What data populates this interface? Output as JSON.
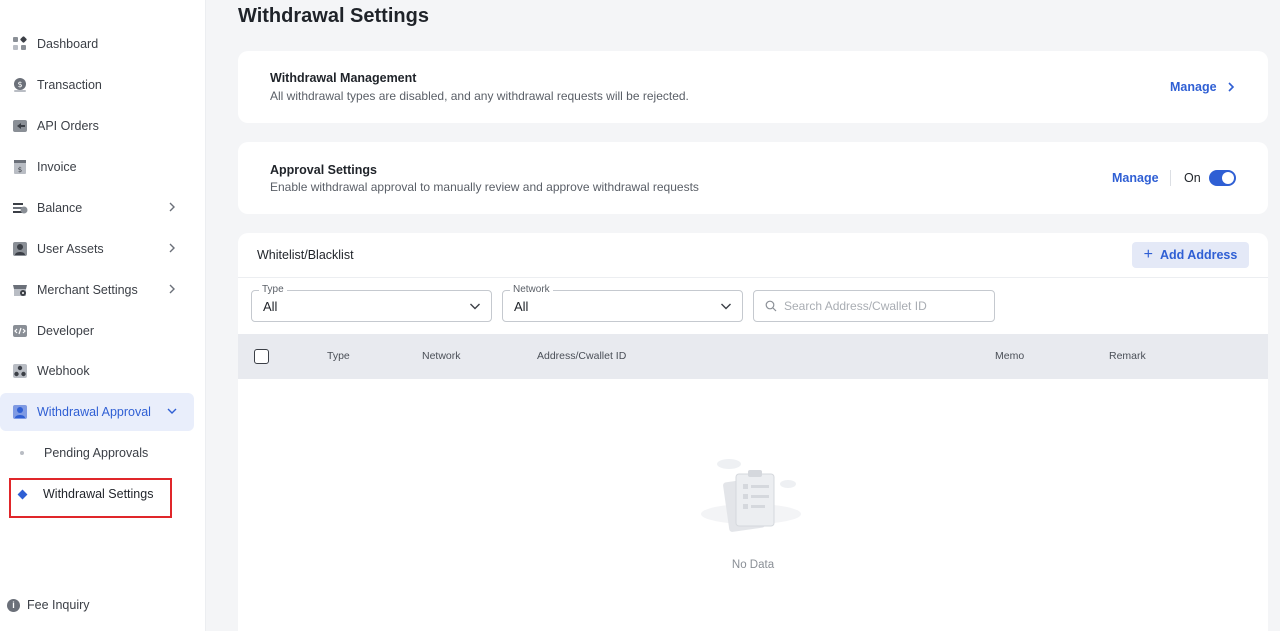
{
  "sidebar": {
    "items": [
      {
        "label": "Dashboard",
        "icon": "dashboard-icon"
      },
      {
        "label": "Transaction",
        "icon": "transaction-icon"
      },
      {
        "label": "API Orders",
        "icon": "api-orders-icon"
      },
      {
        "label": "Invoice",
        "icon": "invoice-icon"
      },
      {
        "label": "Balance",
        "icon": "balance-icon"
      },
      {
        "label": "User Assets",
        "icon": "user-assets-icon"
      },
      {
        "label": "Merchant Settings",
        "icon": "merchant-settings-icon"
      },
      {
        "label": "Developer",
        "icon": "developer-icon"
      },
      {
        "label": "Webhook",
        "icon": "webhook-icon"
      },
      {
        "label": "Withdrawal Approval",
        "icon": "withdrawal-approval-icon"
      }
    ],
    "sub_items": [
      {
        "label": "Pending Approvals"
      },
      {
        "label": "Withdrawal Settings"
      }
    ],
    "fee_inquiry": "Fee Inquiry"
  },
  "page": {
    "title": "Withdrawal Settings"
  },
  "withdrawal_management": {
    "title": "Withdrawal Management",
    "description": "All withdrawal types are disabled, and any withdrawal requests will be rejected.",
    "manage_label": "Manage"
  },
  "approval_settings": {
    "title": "Approval Settings",
    "description": "Enable withdrawal approval to manually review and approve withdrawal requests",
    "manage_label": "Manage",
    "toggle_label": "On"
  },
  "whitelist": {
    "title": "Whitelist/Blacklist",
    "add_label": "Add Address",
    "filters": {
      "type_label": "Type",
      "type_value": "All",
      "network_label": "Network",
      "network_value": "All",
      "search_placeholder": "Search Address/Cwallet ID"
    },
    "columns": [
      "Type",
      "Network",
      "Address/Cwallet ID",
      "Memo",
      "Remark"
    ],
    "empty_text": "No Data"
  },
  "colors": {
    "accent": "#2f5fd4",
    "highlight": "#e0262a"
  }
}
